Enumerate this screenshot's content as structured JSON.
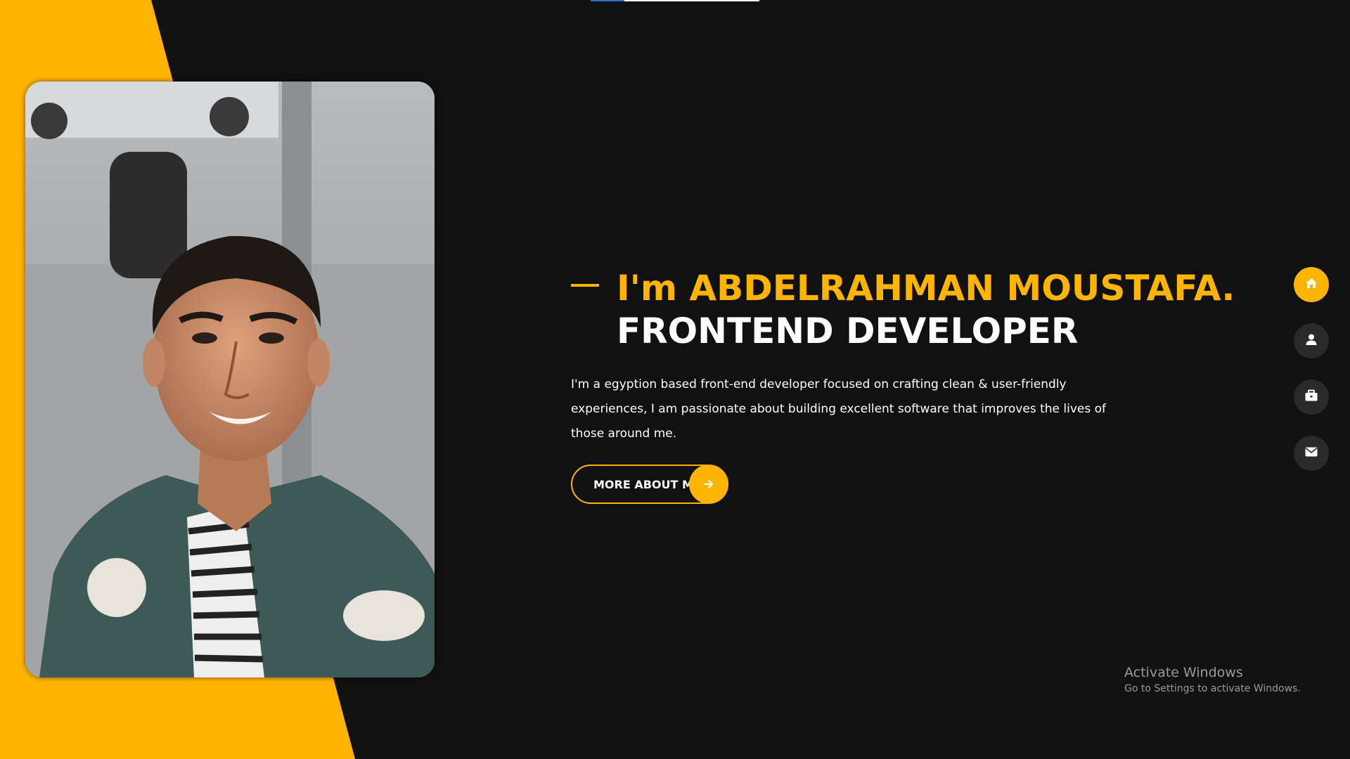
{
  "theme": {
    "accent": "#ffb400",
    "background": "#111111",
    "text": "#ffffff",
    "nav_inactive": "#2b2a2a"
  },
  "scroll_progress": {
    "fraction": 0.2
  },
  "hero": {
    "greeting": "I'm ABDELRAHMAN MOUSTAFA.",
    "role": "FRONTEND DEVELOPER",
    "bio": "I'm a egyption based front-end developer focused on crafting clean & user-friendly experiences, I am passionate about building excellent software that improves the lives of those around me.",
    "cta_label": "MORE ABOUT ME",
    "cta_icon": "arrow-right-icon"
  },
  "portrait": {
    "alt": "portrait photo"
  },
  "side_nav": {
    "items": [
      {
        "icon": "home-icon",
        "active": true
      },
      {
        "icon": "user-icon",
        "active": false
      },
      {
        "icon": "briefcase-icon",
        "active": false
      },
      {
        "icon": "envelope-icon",
        "active": false
      }
    ]
  },
  "os_watermark": {
    "title": "Activate Windows",
    "subtitle": "Go to Settings to activate Windows."
  }
}
